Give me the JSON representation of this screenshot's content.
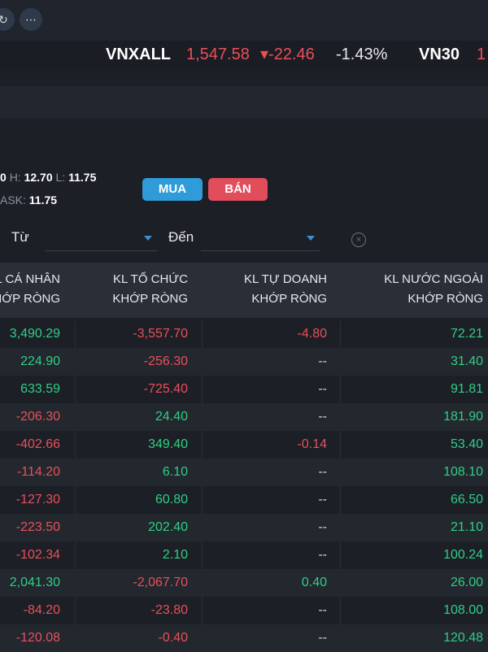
{
  "toolbar": {
    "icon1": "↻",
    "more": "⋯"
  },
  "ticker": {
    "index1_name": "VNXALL",
    "index1_value": "1,547.58",
    "index1_change": "▾-22.46",
    "index1_pct": "-1.43%",
    "index2_name": "VN30",
    "index2_value": "1"
  },
  "quote": {
    "prefix": "0",
    "h_label": "H:",
    "h_value": "12.70",
    "l_label": "L:",
    "l_value": "11.75",
    "ask_label": "ASK:",
    "ask_value": "11.75"
  },
  "actions": {
    "buy": "MUA",
    "sell": "BÁN"
  },
  "filter": {
    "from_label": "Từ",
    "to_label": "Đến"
  },
  "table": {
    "headers": [
      {
        "l1": "L CÁ NHÂN",
        "l2": "HỚP RÒNG"
      },
      {
        "l1": "KL TỔ CHỨC",
        "l2": "KHỚP RÒNG"
      },
      {
        "l1": "KL TỰ DOANH",
        "l2": "KHỚP RÒNG"
      },
      {
        "l1": "KL NƯỚC NGOÀI",
        "l2": "KHỚP RÒNG"
      }
    ],
    "rows": [
      [
        "3,490.29",
        "-3,557.70",
        "-4.80",
        "72.21"
      ],
      [
        "224.90",
        "-256.30",
        "--",
        "31.40"
      ],
      [
        "633.59",
        "-725.40",
        "--",
        "91.81"
      ],
      [
        "-206.30",
        "24.40",
        "--",
        "181.90"
      ],
      [
        "-402.66",
        "349.40",
        "-0.14",
        "53.40"
      ],
      [
        "-114.20",
        "6.10",
        "--",
        "108.10"
      ],
      [
        "-127.30",
        "60.80",
        "--",
        "66.50"
      ],
      [
        "-223.50",
        "202.40",
        "--",
        "21.10"
      ],
      [
        "-102.34",
        "2.10",
        "--",
        "100.24"
      ],
      [
        "2,041.30",
        "-2,067.70",
        "0.40",
        "26.00"
      ],
      [
        "-84.20",
        "-23.80",
        "--",
        "108.00"
      ],
      [
        "-120.08",
        "-0.40",
        "--",
        "120.48"
      ]
    ]
  },
  "colors": {
    "positive": "#2fcf84",
    "negative": "#e9505a",
    "buy": "#2f9bd9",
    "sell": "#e24d5c"
  }
}
